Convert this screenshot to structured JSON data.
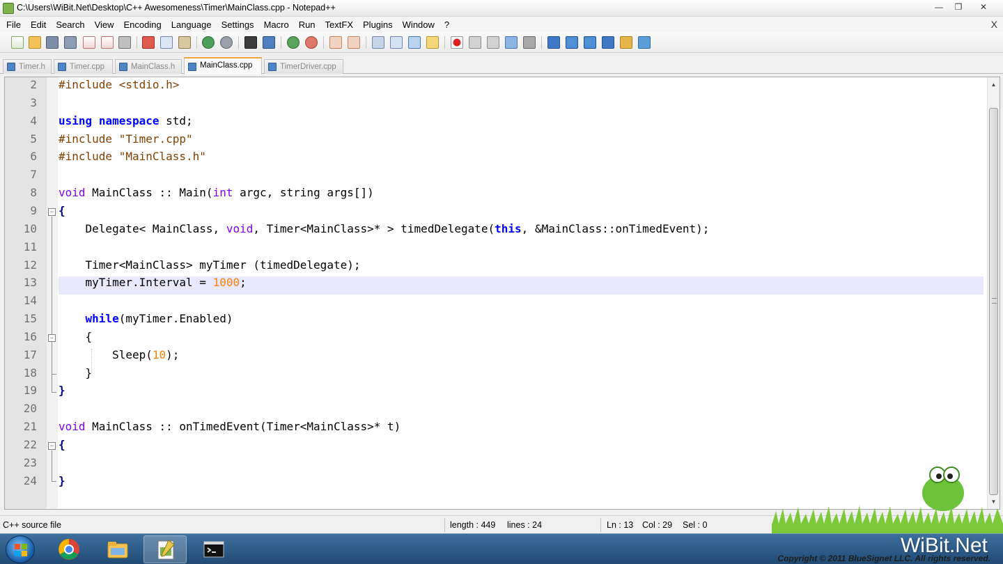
{
  "window": {
    "title": "C:\\Users\\WiBit.Net\\Desktop\\C++ Awesomeness\\Timer\\MainClass.cpp - Notepad++",
    "minimize_glyph": "—",
    "maximize_glyph": "❐",
    "close_glyph": "✕"
  },
  "menu": {
    "items": [
      "File",
      "Edit",
      "Search",
      "View",
      "Encoding",
      "Language",
      "Settings",
      "Macro",
      "Run",
      "TextFX",
      "Plugins",
      "Window",
      "?"
    ],
    "close_glyph": "X"
  },
  "tabs": [
    {
      "label": "Timer.h",
      "active": false
    },
    {
      "label": "Timer.cpp",
      "active": false
    },
    {
      "label": "MainClass.h",
      "active": false
    },
    {
      "label": "MainClass.cpp",
      "active": true
    },
    {
      "label": "TimerDriver.cpp",
      "active": false
    }
  ],
  "editor": {
    "current_line": 13,
    "lines": [
      {
        "n": "2",
        "html": "<span class=\"pp\">#include &lt;stdio.h&gt;</span>"
      },
      {
        "n": "3",
        "html": ""
      },
      {
        "n": "4",
        "html": "<span class=\"kw\">using</span> <span class=\"kw\">namespace</span> std;"
      },
      {
        "n": "5",
        "html": "<span class=\"pp\">#include \"Timer.cpp\"</span>"
      },
      {
        "n": "6",
        "html": "<span class=\"pp\">#include \"MainClass.h\"</span>"
      },
      {
        "n": "7",
        "html": ""
      },
      {
        "n": "8",
        "html": "<span class=\"typ\">void</span> MainClass :: Main(<span class=\"typ\">int</span> argc, string args[])"
      },
      {
        "n": "9",
        "html": "<span class=\"op\">{</span>"
      },
      {
        "n": "10",
        "html": "    Delegate&lt; MainClass, <span class=\"typ\">void</span>, Timer&lt;MainClass&gt;* &gt; timedDelegate(<span class=\"kw\">this</span>, &amp;MainClass::onTimedEvent);"
      },
      {
        "n": "11",
        "html": ""
      },
      {
        "n": "12",
        "html": "    Timer&lt;MainClass&gt; myTimer (timedDelegate);"
      },
      {
        "n": "13",
        "html": "    myTimer.Interval = <span class=\"num\">1000</span>;"
      },
      {
        "n": "14",
        "html": ""
      },
      {
        "n": "15",
        "html": "    <span class=\"kw\">while</span>(myTimer.Enabled)"
      },
      {
        "n": "16",
        "html": "    {"
      },
      {
        "n": "17",
        "html": "        Sleep(<span class=\"num\">10</span>);"
      },
      {
        "n": "18",
        "html": "    }"
      },
      {
        "n": "19",
        "html": "<span class=\"op\">}</span>"
      },
      {
        "n": "20",
        "html": ""
      },
      {
        "n": "21",
        "html": "<span class=\"typ\">void</span> MainClass :: onTimedEvent(Timer&lt;MainClass&gt;* t)"
      },
      {
        "n": "22",
        "html": "<span class=\"op\">{</span>"
      },
      {
        "n": "23",
        "html": ""
      },
      {
        "n": "24",
        "html": "<span class=\"op\">}</span>"
      }
    ]
  },
  "status": {
    "file_type": "C++ source file",
    "length": "length : 449",
    "lines": "lines : 24",
    "ln": "Ln : 13",
    "col": "Col : 29",
    "sel": "Sel : 0"
  },
  "branding": {
    "logo": "WiBit.Net",
    "copyright": "Copyright © 2011 BlueSignet LLC. All rights reserved."
  },
  "colors": {
    "current_line_bg": "#e8e8ff",
    "active_tab_accent": "#f2a13a",
    "keyword": "#0000ff",
    "type": "#8000ff",
    "preprocessor": "#804000",
    "number": "#ff8000"
  },
  "toolbar_icons": [
    "new-file-icon",
    "open-file-icon",
    "save-icon",
    "save-all-icon",
    "close-icon",
    "close-all-icon",
    "print-icon",
    "cut-icon",
    "copy-icon",
    "paste-icon",
    "undo-icon",
    "redo-icon",
    "find-icon",
    "replace-icon",
    "zoom-in-icon",
    "zoom-out-icon",
    "sync-v-icon",
    "sync-h-icon",
    "wrap-icon",
    "show-all-chars-icon",
    "indent-guide-icon",
    "doc-map-icon",
    "record-macro-icon",
    "stop-macro-icon",
    "play-macro-icon",
    "run-macro-multiple-icon",
    "save-macro-icon",
    "textfx-1-icon",
    "textfx-2-icon",
    "textfx-3-icon",
    "textfx-4-icon",
    "textfx-5-icon",
    "spellcheck-icon"
  ]
}
